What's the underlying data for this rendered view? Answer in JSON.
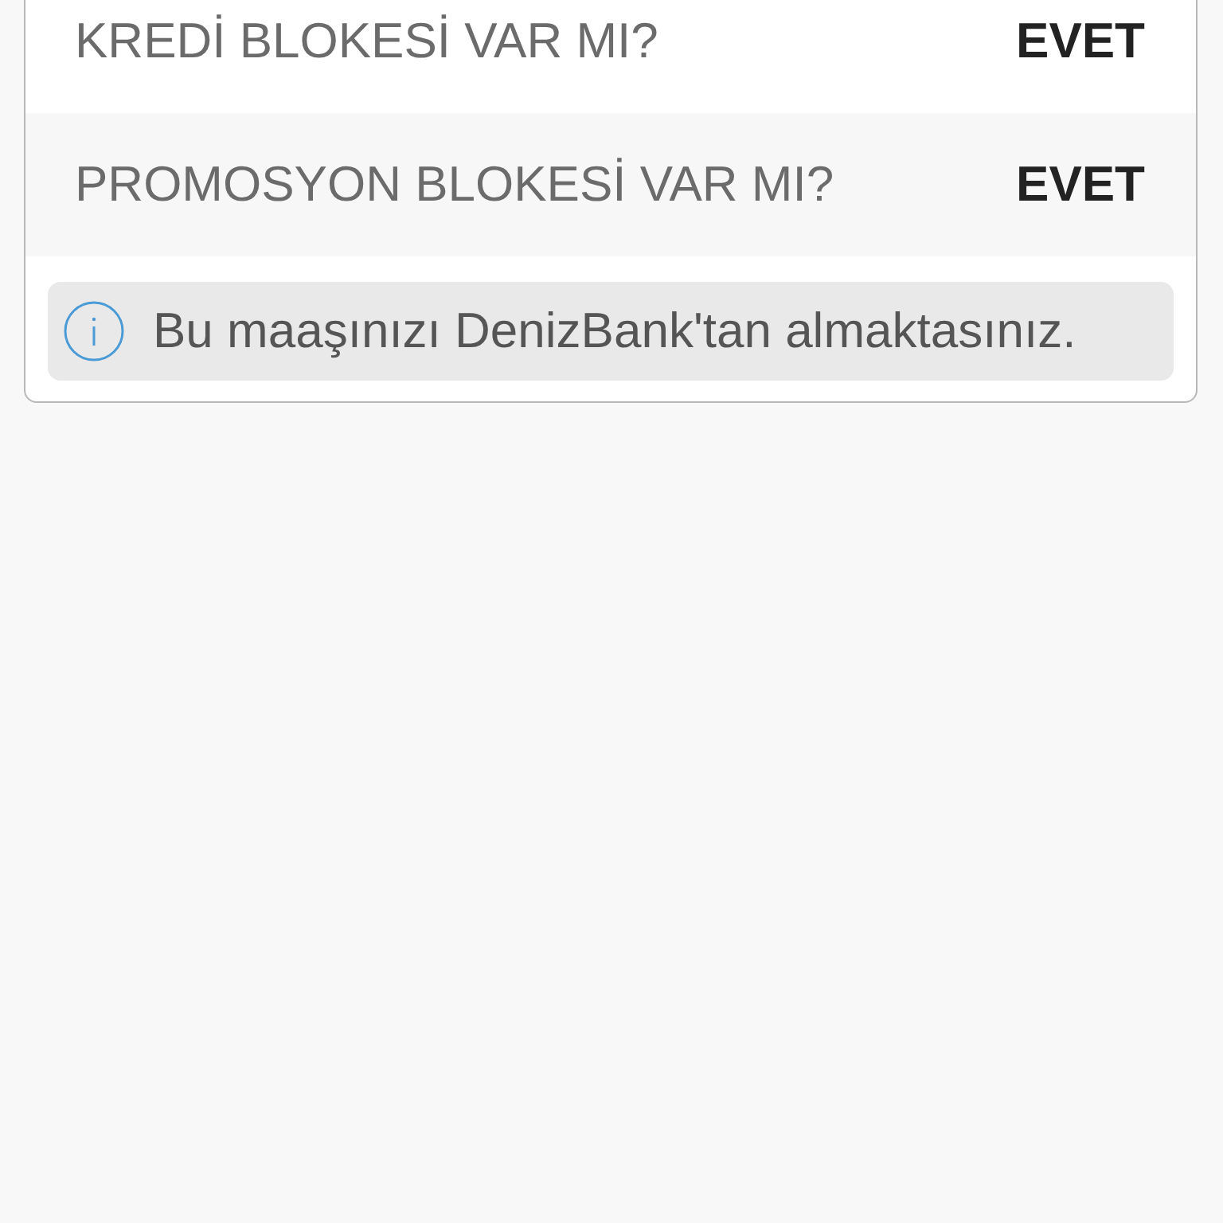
{
  "rows": [
    {
      "label": "KREDİ BLOKESİ VAR MI?",
      "value": "EVET"
    },
    {
      "label": "PROMOSYON BLOKESİ VAR MI?",
      "value": "EVET"
    }
  ],
  "info": {
    "text": "Bu maaşınızı DenizBank'tan almaktasınız."
  }
}
